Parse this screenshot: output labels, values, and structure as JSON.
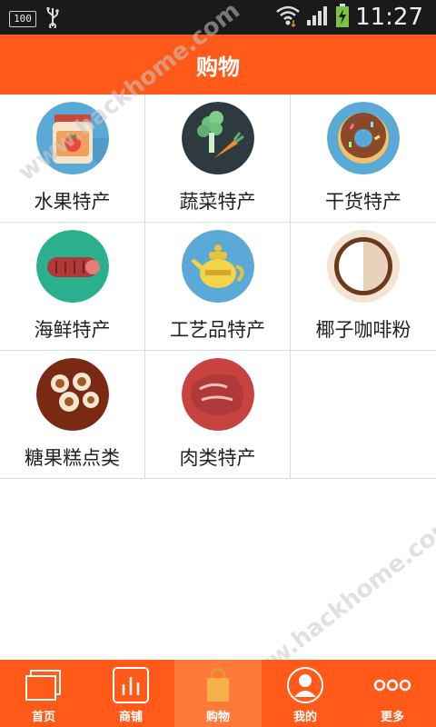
{
  "status_bar": {
    "battery_small_label": "100",
    "time": "11:27"
  },
  "header": {
    "title": "购物"
  },
  "categories": [
    {
      "label": "水果特产",
      "icon": "jam-jar-icon",
      "bg": "#5aa9d6"
    },
    {
      "label": "蔬菜特产",
      "icon": "vegetables-icon",
      "bg": "#2e3a40"
    },
    {
      "label": "干货特产",
      "icon": "donut-icon",
      "bg": "#5aa9d6"
    },
    {
      "label": "海鲜特产",
      "icon": "sausage-icon",
      "bg": "#2bb08e"
    },
    {
      "label": "工艺品特产",
      "icon": "teapot-icon",
      "bg": "#5aa9d6"
    },
    {
      "label": "椰子咖啡粉",
      "icon": "coconut-icon",
      "bg": "#f3e3d3"
    },
    {
      "label": "糖果糕点类",
      "icon": "swiss-roll-icon",
      "bg": "#7a2a12"
    },
    {
      "label": "肉类特产",
      "icon": "meat-icon",
      "bg": "#c8423f"
    }
  ],
  "tabs": [
    {
      "label": "首页",
      "icon": "home-pages-icon",
      "active": false
    },
    {
      "label": "商铺",
      "icon": "shop-chart-icon",
      "active": false
    },
    {
      "label": "购物",
      "icon": "shopping-bag-icon",
      "active": true
    },
    {
      "label": "我的",
      "icon": "profile-icon",
      "active": false
    },
    {
      "label": "更多",
      "icon": "more-icon",
      "active": false
    }
  ],
  "watermark": "www.hackhome.com",
  "colors": {
    "accent": "#ff5a1a",
    "status_bar": "#1a1a1a",
    "grid_line": "#dcdcdc"
  }
}
